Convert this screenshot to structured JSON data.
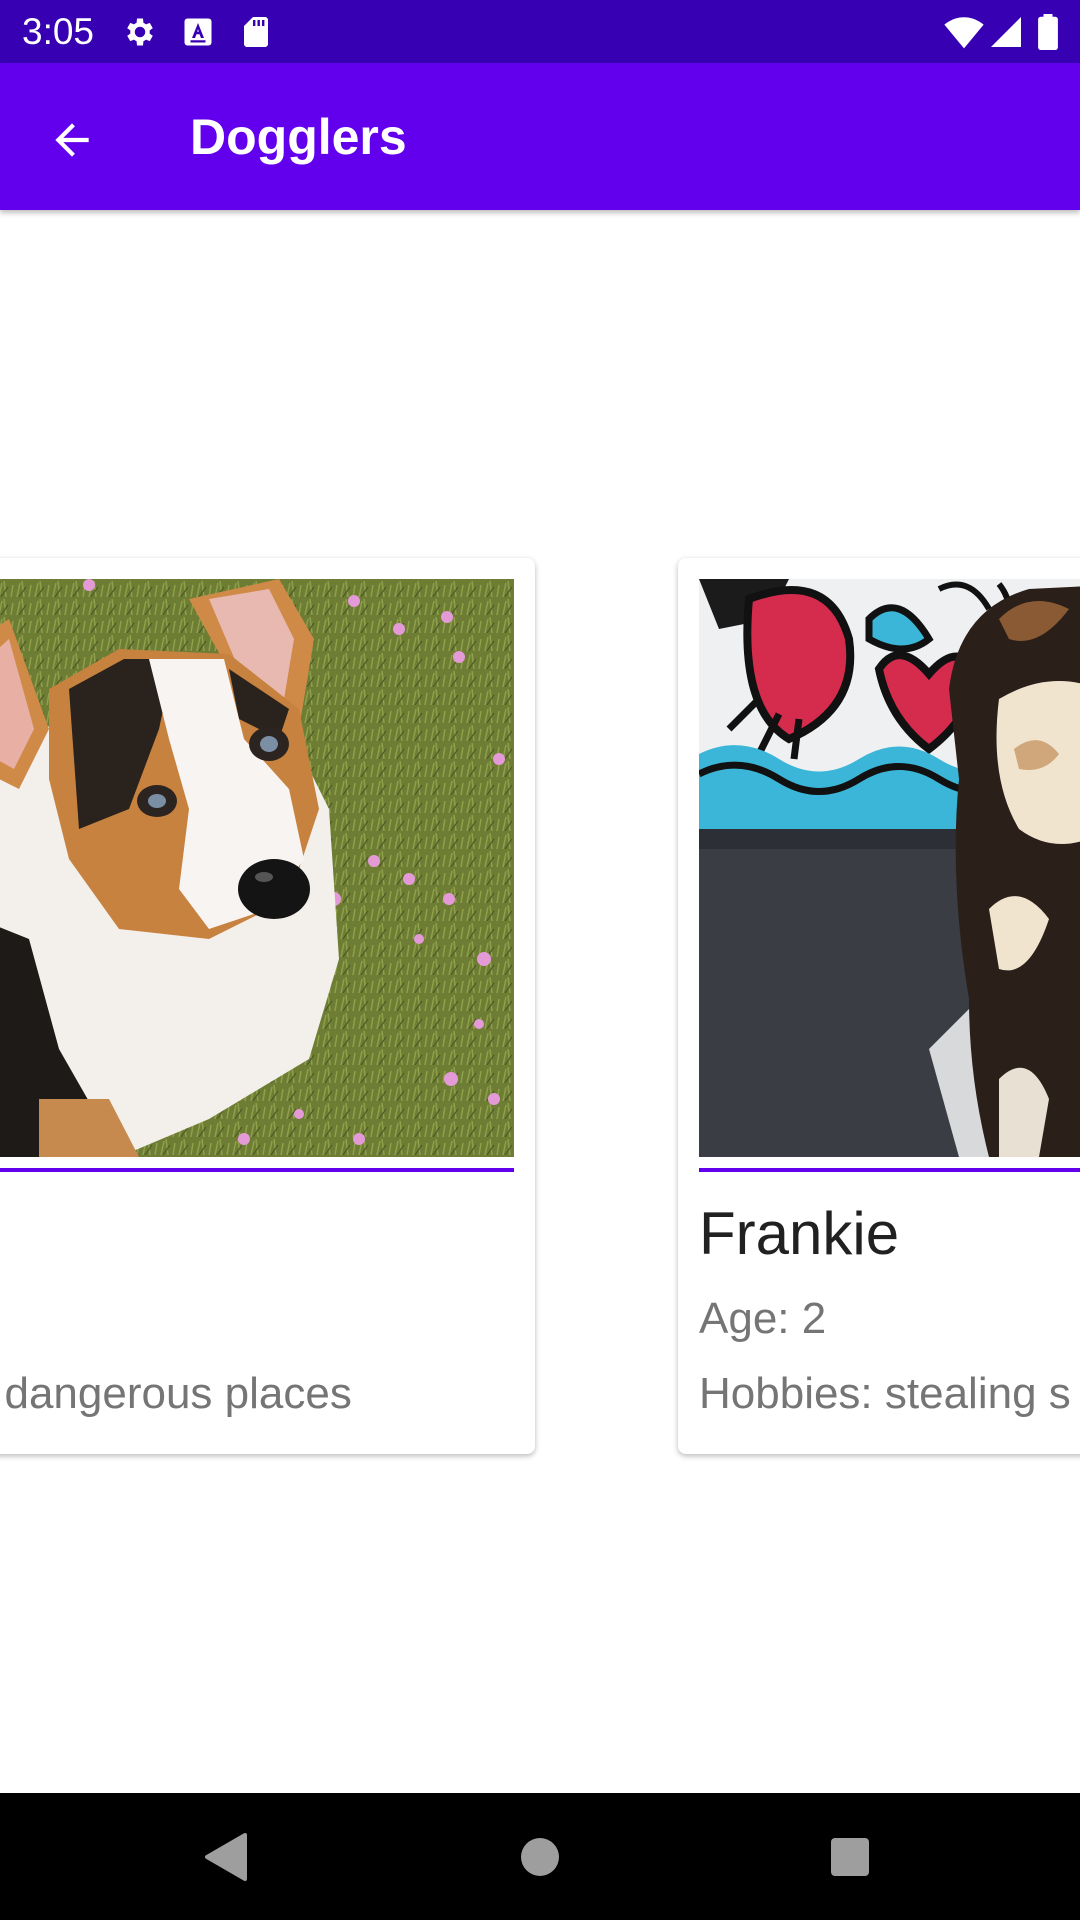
{
  "status_bar": {
    "time": "3:05",
    "left_icons": [
      "settings-icon",
      "keyboard-a-icon",
      "sd-card-icon"
    ],
    "right_icons": [
      "wifi-icon",
      "cell-signal-icon",
      "battery-icon"
    ]
  },
  "app_bar": {
    "title": "Dogglers",
    "back_icon": "arrow-back-icon"
  },
  "cards": [
    {
      "name": "",
      "age": "",
      "hobbies": "in dangerous places",
      "photo": "corgi-photo"
    },
    {
      "name": "Frankie",
      "age": "Age: 2",
      "hobbies": "Hobbies: stealing s",
      "photo": "frankie-photo"
    }
  ],
  "nav_bar": {
    "back": "nav-back-icon",
    "home": "nav-home-icon",
    "recents": "nav-recents-icon"
  },
  "colors": {
    "status_bar": "#3700b3",
    "primary": "#6200ee",
    "divider": "#6200ee"
  }
}
